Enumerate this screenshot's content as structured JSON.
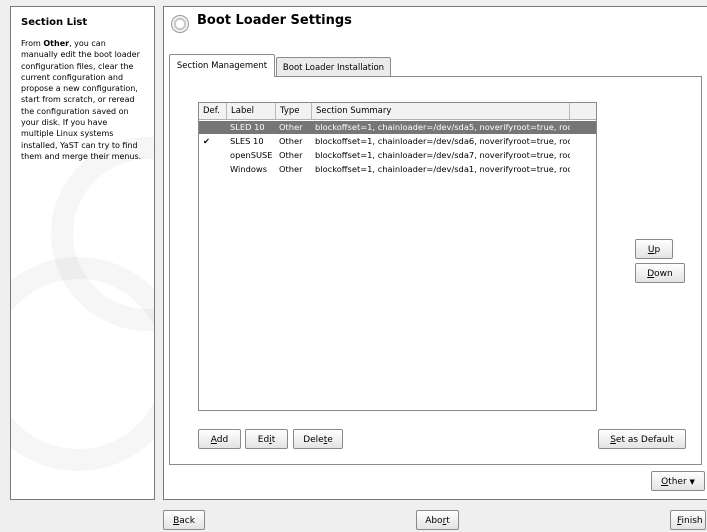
{
  "help": {
    "title": "Section List",
    "lines": [
      [
        "From ",
        "Other",
        ", you can"
      ],
      [
        "manually edit the boot loader"
      ],
      [
        "configuration files, clear the"
      ],
      [
        "current configuration and"
      ],
      [
        "propose a new configuration,"
      ],
      [
        "start from scratch, or reread"
      ],
      [
        "the configuration saved on"
      ],
      [
        "your disk. If you have"
      ],
      [
        "multiple Linux systems"
      ],
      [
        "installed, YaST can try to find"
      ],
      [
        "them and merge their menus."
      ]
    ]
  },
  "main": {
    "title": "Boot Loader Settings",
    "icon": "yast-icon",
    "tabs": [
      {
        "label": "Section Management",
        "active": true
      },
      {
        "label": "Boot Loader Installation",
        "active": false
      }
    ],
    "table": {
      "columns": [
        "Def.",
        "Label",
        "Type",
        "Section Summary"
      ],
      "rows": [
        {
          "def": "",
          "label": "SLED 10",
          "type": "Other",
          "summary": "blockoffset=1, chainloader=/dev/sda5, noverifyroot=true, root=",
          "selected": true
        },
        {
          "def": "✔",
          "label": "SLES 10",
          "type": "Other",
          "summary": "blockoffset=1, chainloader=/dev/sda6, noverifyroot=true, root=",
          "selected": false
        },
        {
          "def": "",
          "label": "openSUSE",
          "type": "Other",
          "summary": "blockoffset=1, chainloader=/dev/sda7, noverifyroot=true, root=",
          "selected": false
        },
        {
          "def": "",
          "label": "Windows",
          "type": "Other",
          "summary": "blockoffset=1, chainloader=/dev/sda1, noverifyroot=true, root=",
          "selected": false
        }
      ]
    },
    "buttons": {
      "up": {
        "pre": "",
        "mn": "U",
        "post": "p"
      },
      "down": {
        "pre": "",
        "mn": "D",
        "post": "own"
      },
      "add": {
        "pre": "",
        "mn": "A",
        "post": "dd"
      },
      "edit": {
        "pre": "Ed",
        "mn": "i",
        "post": "t"
      },
      "delete": {
        "pre": "Dele",
        "mn": "t",
        "post": "e"
      },
      "set_default": {
        "pre": "",
        "mn": "S",
        "post": "et as Default"
      },
      "other": {
        "pre": "",
        "mn": "O",
        "post": "ther",
        "arrow": "▼"
      }
    }
  },
  "footer": {
    "back": {
      "pre": "",
      "mn": "B",
      "post": "ack"
    },
    "abort": {
      "pre": "Abo",
      "mn": "r",
      "post": "t"
    },
    "finish": {
      "pre": "",
      "mn": "F",
      "post": "inish"
    }
  }
}
